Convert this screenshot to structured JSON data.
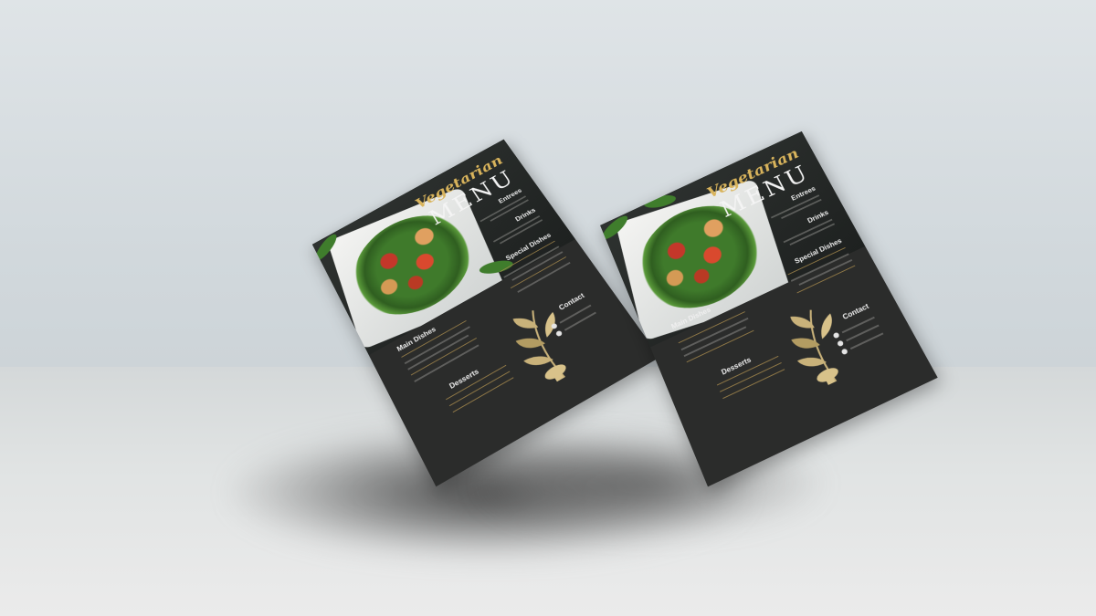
{
  "menu": {
    "script_title": "Vegetarian",
    "main_title": "MENU",
    "sections": {
      "entrees": "Entrees",
      "drinks": "Drinks",
      "special": "Special Dishes",
      "main": "Main Dishes",
      "desserts": "Desserts",
      "contact": "Contact"
    }
  },
  "colors": {
    "flyer_bg": "#2b2c2b",
    "accent_gold": "#d9b45c",
    "wall": "#d1d8dc",
    "floor": "#e0e3e3"
  }
}
